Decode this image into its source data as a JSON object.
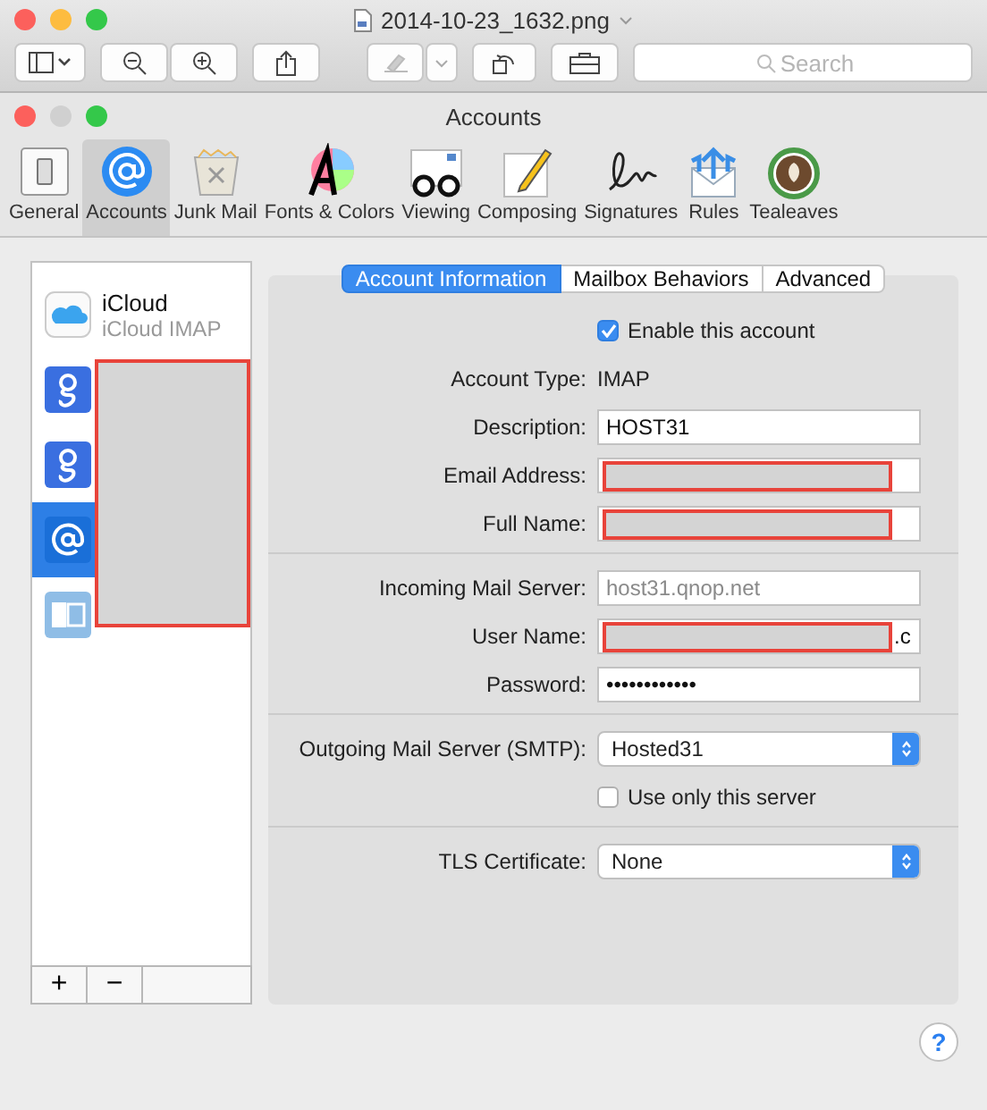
{
  "preview": {
    "title": "2014-10-23_1632.png",
    "search": {
      "placeholder": "Search"
    }
  },
  "window": {
    "title": "Accounts"
  },
  "prefs_tabs": [
    {
      "kind": "general",
      "label": "General",
      "selected": false
    },
    {
      "kind": "accounts",
      "label": "Accounts",
      "selected": true
    },
    {
      "kind": "junk",
      "label": "Junk Mail",
      "selected": false
    },
    {
      "kind": "fonts",
      "label": "Fonts & Colors",
      "selected": false
    },
    {
      "kind": "viewing",
      "label": "Viewing",
      "selected": false
    },
    {
      "kind": "composing",
      "label": "Composing",
      "selected": false
    },
    {
      "kind": "signatures",
      "label": "Signatures",
      "selected": false
    },
    {
      "kind": "rules",
      "label": "Rules",
      "selected": false
    },
    {
      "kind": "tealeaves",
      "label": "Tealeaves",
      "selected": false
    }
  ],
  "accounts": [
    {
      "kind": "icloud",
      "name": "iCloud",
      "subtitle": "iCloud IMAP",
      "selected": false
    },
    {
      "kind": "google",
      "selected": false
    },
    {
      "kind": "google",
      "selected": false
    },
    {
      "kind": "mail",
      "selected": true
    },
    {
      "kind": "exchange",
      "selected": false
    }
  ],
  "sub_tabs": [
    {
      "label": "Account Information",
      "selected": true
    },
    {
      "label": "Mailbox Behaviors",
      "selected": false
    },
    {
      "label": "Advanced",
      "selected": false
    }
  ],
  "enable": {
    "label": "Enable this account",
    "checked": true
  },
  "fields": [
    {
      "kind": "static",
      "label": "Account Type:",
      "value": "IMAP"
    },
    {
      "kind": "text",
      "label": "Description:",
      "value": "HOST31"
    },
    {
      "kind": "redacted",
      "label": "Email Address:"
    },
    {
      "kind": "redacted",
      "label": "Full Name:"
    },
    {
      "kind": "divider"
    },
    {
      "kind": "text",
      "label": "Incoming Mail Server:",
      "placeholder": "host31.qnop.net"
    },
    {
      "kind": "redacted",
      "label": "User Name:",
      "suffix": ".c"
    },
    {
      "kind": "text",
      "label": "Password:",
      "value": "••••••••••••"
    },
    {
      "kind": "divider"
    },
    {
      "kind": "select",
      "label": "Outgoing Mail Server (SMTP):",
      "value": "Hosted31"
    },
    {
      "kind": "checkbox",
      "label": "Use only this server",
      "checked": false
    },
    {
      "kind": "divider"
    },
    {
      "kind": "select",
      "label": "TLS Certificate:",
      "value": "None"
    }
  ],
  "list_buttons": [
    "+",
    "−"
  ],
  "help": "?"
}
